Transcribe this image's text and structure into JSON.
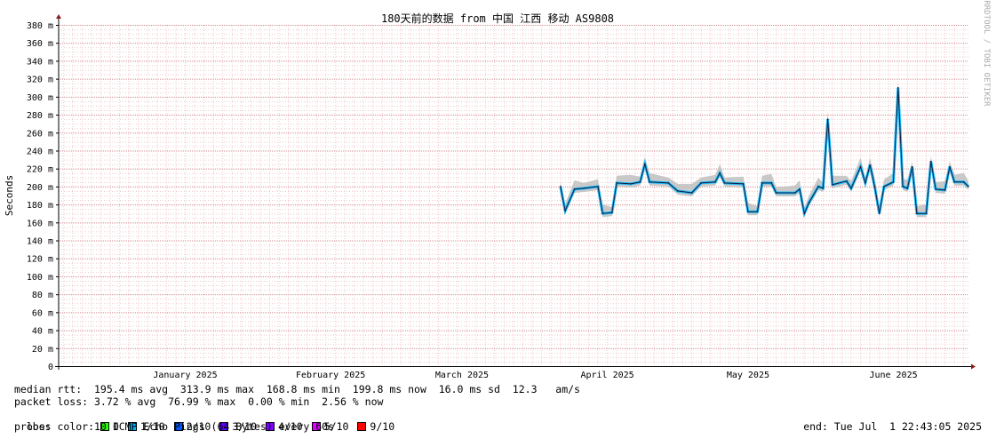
{
  "chart_data": {
    "type": "line",
    "title": "180天前的数据 from 中国 江西 移动 AS9808",
    "ylabel": "Seconds",
    "credit": "RRDTOOL / TOBI OETIKER",
    "ylim": [
      0,
      380
    ],
    "yticks": [
      "0",
      "20 m",
      "40 m",
      "60 m",
      "80 m",
      "100 m",
      "120 m",
      "140 m",
      "160 m",
      "180 m",
      "200 m",
      "220 m",
      "240 m",
      "260 m",
      "280 m",
      "300 m",
      "320 m",
      "340 m",
      "360 m",
      "380 m"
    ],
    "xlim": [
      "2024-12-19",
      "2025-07-01"
    ],
    "xticks": [
      {
        "date": "2025-01-15",
        "label": "January 2025"
      },
      {
        "date": "2025-02-15",
        "label": "February 2025"
      },
      {
        "date": "2025-03-15",
        "label": "March 2025"
      },
      {
        "date": "2025-04-15",
        "label": "April 2025"
      },
      {
        "date": "2025-05-15",
        "label": "May 2025"
      },
      {
        "date": "2025-06-15",
        "label": "June 2025"
      }
    ],
    "grid": true,
    "series": [
      {
        "name": "median rtt",
        "units": "ms",
        "points": [
          [
            "2025-04-05",
            200
          ],
          [
            "2025-04-06",
            173
          ],
          [
            "2025-04-08",
            197
          ],
          [
            "2025-04-10",
            198
          ],
          [
            "2025-04-13",
            200
          ],
          [
            "2025-04-14",
            170
          ],
          [
            "2025-04-16",
            171
          ],
          [
            "2025-04-17",
            204
          ],
          [
            "2025-04-20",
            203
          ],
          [
            "2025-04-22",
            205
          ],
          [
            "2025-04-23",
            225
          ],
          [
            "2025-04-24",
            205
          ],
          [
            "2025-04-28",
            204
          ],
          [
            "2025-04-30",
            195
          ],
          [
            "2025-05-03",
            193
          ],
          [
            "2025-05-05",
            204
          ],
          [
            "2025-05-08",
            205
          ],
          [
            "2025-05-09",
            215
          ],
          [
            "2025-05-10",
            204
          ],
          [
            "2025-05-14",
            203
          ],
          [
            "2025-05-15",
            172
          ],
          [
            "2025-05-17",
            172
          ],
          [
            "2025-05-18",
            204
          ],
          [
            "2025-05-20",
            204
          ],
          [
            "2025-05-21",
            193
          ],
          [
            "2025-05-25",
            193
          ],
          [
            "2025-05-26",
            197
          ],
          [
            "2025-05-27",
            170
          ],
          [
            "2025-05-28",
            182
          ],
          [
            "2025-05-30",
            200
          ],
          [
            "2025-05-31",
            198
          ],
          [
            "2025-06-01",
            275
          ],
          [
            "2025-06-02",
            202
          ],
          [
            "2025-06-05",
            206
          ],
          [
            "2025-06-06",
            198
          ],
          [
            "2025-06-08",
            222
          ],
          [
            "2025-06-09",
            204
          ],
          [
            "2025-06-10",
            224
          ],
          [
            "2025-06-11",
            200
          ],
          [
            "2025-06-12",
            170
          ],
          [
            "2025-06-13",
            200
          ],
          [
            "2025-06-15",
            205
          ],
          [
            "2025-06-16",
            310
          ],
          [
            "2025-06-17",
            200
          ],
          [
            "2025-06-18",
            198
          ],
          [
            "2025-06-19",
            222
          ],
          [
            "2025-06-20",
            170
          ],
          [
            "2025-06-22",
            170
          ],
          [
            "2025-06-23",
            228
          ],
          [
            "2025-06-24",
            197
          ],
          [
            "2025-06-26",
            196
          ],
          [
            "2025-06-27",
            222
          ],
          [
            "2025-06-28",
            205
          ],
          [
            "2025-06-30",
            205
          ],
          [
            "2025-07-01",
            200
          ]
        ]
      }
    ]
  },
  "stats": {
    "median_rtt": "median rtt:  195.4 ms avg  313.9 ms max  168.8 ms min  199.8 ms now  16.0 ms sd  12.3   am/s",
    "packet_loss": "packet loss: 3.72 % avg  76.99 % max  0.00 % min  2.56 % now",
    "loss_color_label": "loss color:",
    "probe": "probe:       10 ICMP Echo Pings (64 Bytes) every 60s",
    "end": "end: Tue Jul  1 22:43:05 2025"
  },
  "loss_colors": [
    {
      "label": "0",
      "color": "#26ff00"
    },
    {
      "label": "1/10",
      "color": "#00b8ff"
    },
    {
      "label": "2/10",
      "color": "#0059ff"
    },
    {
      "label": "3/10",
      "color": "#5e00ff"
    },
    {
      "label": "4/10",
      "color": "#7e00ff"
    },
    {
      "label": "5/10",
      "color": "#dd00ff"
    },
    {
      "label": "9/10",
      "color": "#ff0000"
    }
  ],
  "colors": {
    "grid_minor": "#f2c6c6",
    "grid_major": "#d98c8c",
    "axis": "#000000",
    "arrow": "#8b1a1a",
    "smoke": "#c0c0c0",
    "median_line": "#1a1a3a",
    "median_fill": "#00b8ff"
  }
}
